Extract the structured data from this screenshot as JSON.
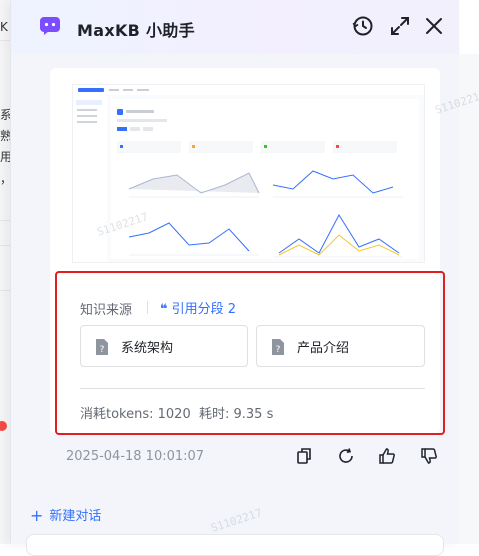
{
  "background_page": {
    "fragments": [
      "K",
      "系",
      "熟",
      "用",
      "，"
    ]
  },
  "header": {
    "title": "MaxKB 小助手",
    "icons": [
      "assistant-logo-icon",
      "history-icon",
      "expand-icon",
      "close-icon"
    ]
  },
  "message": {
    "knowledge_source_label": "知识来源",
    "citation_label": "引用分段 2",
    "documents": [
      {
        "name": "系统架构",
        "icon": "document-icon"
      },
      {
        "name": "产品介绍",
        "icon": "document-icon"
      }
    ],
    "usage_text": "消耗tokens: 1020  耗时: 9.35 s",
    "timestamp": "2025-04-18 10:01:07",
    "actions": [
      "copy-icon",
      "regenerate-icon",
      "thumbs-up-icon",
      "thumbs-down-icon"
    ]
  },
  "footer": {
    "new_chat_label": "新建对话"
  },
  "watermark": "S1102217",
  "colors": {
    "accent": "#3370ff",
    "highlight_border": "#e02020",
    "logo": "#7c4dff"
  }
}
